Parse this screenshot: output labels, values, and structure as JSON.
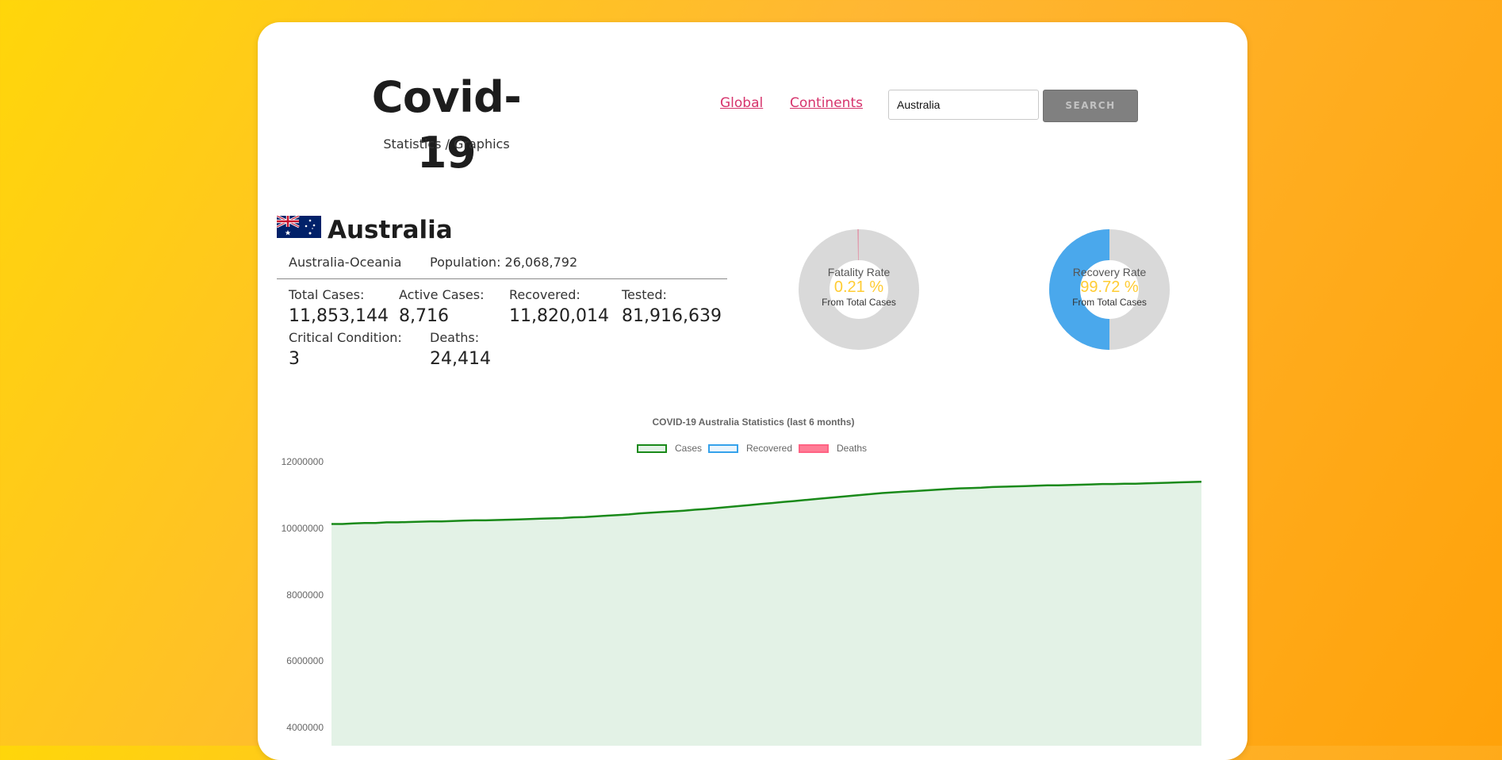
{
  "header": {
    "title": "Covid-19",
    "subtitle": "Statistics / Graphics",
    "nav": [
      "Global",
      "Continents"
    ],
    "search_value": "Australia",
    "search_button": "SEARCH"
  },
  "country": {
    "name": "Australia",
    "continent": "Australia-Oceania",
    "population_text": "Population: 26,068,792"
  },
  "stats": [
    {
      "label": "Total Cases:",
      "value": "11,853,144"
    },
    {
      "label": "Active Cases:",
      "value": "8,716"
    },
    {
      "label": "Recovered:",
      "value": "11,820,014"
    },
    {
      "label": "Tested:",
      "value": "81,916,639"
    },
    {
      "label": "Critical Condition:",
      "value": "3"
    },
    {
      "label": "Deaths:",
      "value": "24,414"
    }
  ],
  "donuts": [
    {
      "title": "Fatality Rate",
      "pct_text": "0.21 %",
      "sub": "From Total Cases",
      "fraction": 0.0021,
      "fill_color": "#e0a0b0"
    },
    {
      "title": "Recovery Rate",
      "pct_text": "99.72 %",
      "sub": "From Total Cases",
      "fraction": 0.5,
      "fill_color": "#4aa8ec"
    }
  ],
  "colors": {
    "accent_link": "#d6336c",
    "cases_line": "#1a8a1a",
    "cases_fill": "#e3f2e6",
    "recovered": "#36a2eb",
    "deaths": "#ff6384",
    "donut_track": "#d9d9d9",
    "pct_text": "#ffcc33"
  },
  "chart_data": {
    "type": "area",
    "title": "COVID-19 Australia Statistics (last 6 months)",
    "legend": [
      "Cases",
      "Recovered",
      "Deaths"
    ],
    "legend_position": "top",
    "y_ticks": [
      "12000000",
      "10000000",
      "8000000",
      "6000000",
      "4000000"
    ],
    "ylim": [
      4000000,
      12000000
    ],
    "grid": false,
    "series": [
      {
        "name": "Cases",
        "values": [
          10130000,
          10130000,
          10150000,
          10160000,
          10160000,
          10180000,
          10180000,
          10190000,
          10200000,
          10210000,
          10210000,
          10220000,
          10230000,
          10240000,
          10240000,
          10250000,
          10260000,
          10270000,
          10280000,
          10290000,
          10300000,
          10310000,
          10330000,
          10340000,
          10360000,
          10380000,
          10400000,
          10420000,
          10450000,
          10470000,
          10490000,
          10510000,
          10530000,
          10560000,
          10580000,
          10610000,
          10640000,
          10670000,
          10700000,
          10730000,
          10760000,
          10790000,
          10820000,
          10850000,
          10880000,
          10910000,
          10940000,
          10970000,
          11000000,
          11030000,
          11060000,
          11080000,
          11100000,
          11120000,
          11140000,
          11160000,
          11180000,
          11200000,
          11210000,
          11220000,
          11240000,
          11250000,
          11260000,
          11270000,
          11280000,
          11290000,
          11290000,
          11300000,
          11310000,
          11320000,
          11330000,
          11330000,
          11340000,
          11340000,
          11350000,
          11360000,
          11370000,
          11380000,
          11390000,
          11400000
        ]
      },
      {
        "name": "Recovered",
        "values": []
      },
      {
        "name": "Deaths",
        "values": []
      }
    ]
  }
}
